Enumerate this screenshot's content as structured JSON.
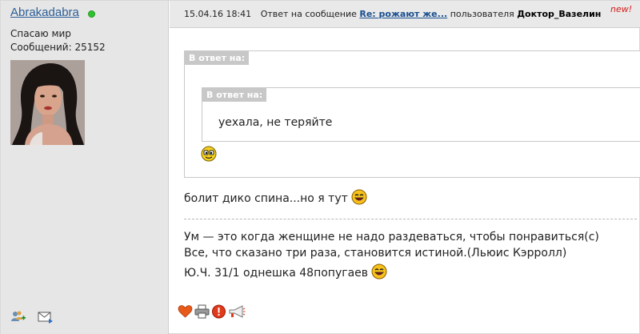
{
  "user": {
    "name": "Abrakadabra",
    "status": "Спасаю мир",
    "posts": "Сообщений: 25152",
    "online_color": "#2ec22e"
  },
  "header": {
    "date": "15.04.16 18:41",
    "reply_text": "Ответ на сообщение",
    "thread_link": "Re: рожают же...",
    "user_text": "пользователя",
    "to_user": "Доктор_Вазелин",
    "new_badge": "new!"
  },
  "quote": {
    "outer_label": "В ответ на:",
    "inner_label": "В ответ на:",
    "inner_text": "уехала, не теряйте"
  },
  "message": {
    "text": "болит дико спина...но я тут"
  },
  "signature": {
    "line1": "Ум — это когда женщине не надо раздеваться, чтобы понравиться(с)",
    "line2": "Все, что сказано три раза, становится истиной.(Льюис Кэрролл)",
    "line3": "Ю.Ч. 31/1 однешка 48попугаев"
  },
  "icons": {
    "user_actions": [
      "add-friend-icon",
      "message-icon"
    ],
    "post_actions": [
      "heart-icon",
      "print-icon",
      "report-icon",
      "megaphone-icon"
    ]
  },
  "colors": {
    "link": "#1a4f8f",
    "new_badge": "#d61a1a",
    "quote_label_bg": "#c8c8c8"
  }
}
